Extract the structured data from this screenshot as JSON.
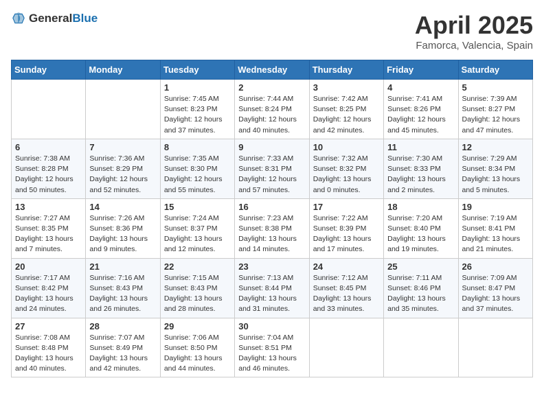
{
  "header": {
    "logo_general": "General",
    "logo_blue": "Blue",
    "month_year": "April 2025",
    "location": "Famorca, Valencia, Spain"
  },
  "weekdays": [
    "Sunday",
    "Monday",
    "Tuesday",
    "Wednesday",
    "Thursday",
    "Friday",
    "Saturday"
  ],
  "weeks": [
    [
      null,
      null,
      {
        "day": 1,
        "sunrise": "7:45 AM",
        "sunset": "8:23 PM",
        "daylight": "12 hours and 37 minutes."
      },
      {
        "day": 2,
        "sunrise": "7:44 AM",
        "sunset": "8:24 PM",
        "daylight": "12 hours and 40 minutes."
      },
      {
        "day": 3,
        "sunrise": "7:42 AM",
        "sunset": "8:25 PM",
        "daylight": "12 hours and 42 minutes."
      },
      {
        "day": 4,
        "sunrise": "7:41 AM",
        "sunset": "8:26 PM",
        "daylight": "12 hours and 45 minutes."
      },
      {
        "day": 5,
        "sunrise": "7:39 AM",
        "sunset": "8:27 PM",
        "daylight": "12 hours and 47 minutes."
      }
    ],
    [
      {
        "day": 6,
        "sunrise": "7:38 AM",
        "sunset": "8:28 PM",
        "daylight": "12 hours and 50 minutes."
      },
      {
        "day": 7,
        "sunrise": "7:36 AM",
        "sunset": "8:29 PM",
        "daylight": "12 hours and 52 minutes."
      },
      {
        "day": 8,
        "sunrise": "7:35 AM",
        "sunset": "8:30 PM",
        "daylight": "12 hours and 55 minutes."
      },
      {
        "day": 9,
        "sunrise": "7:33 AM",
        "sunset": "8:31 PM",
        "daylight": "12 hours and 57 minutes."
      },
      {
        "day": 10,
        "sunrise": "7:32 AM",
        "sunset": "8:32 PM",
        "daylight": "13 hours and 0 minutes."
      },
      {
        "day": 11,
        "sunrise": "7:30 AM",
        "sunset": "8:33 PM",
        "daylight": "13 hours and 2 minutes."
      },
      {
        "day": 12,
        "sunrise": "7:29 AM",
        "sunset": "8:34 PM",
        "daylight": "13 hours and 5 minutes."
      }
    ],
    [
      {
        "day": 13,
        "sunrise": "7:27 AM",
        "sunset": "8:35 PM",
        "daylight": "13 hours and 7 minutes."
      },
      {
        "day": 14,
        "sunrise": "7:26 AM",
        "sunset": "8:36 PM",
        "daylight": "13 hours and 9 minutes."
      },
      {
        "day": 15,
        "sunrise": "7:24 AM",
        "sunset": "8:37 PM",
        "daylight": "13 hours and 12 minutes."
      },
      {
        "day": 16,
        "sunrise": "7:23 AM",
        "sunset": "8:38 PM",
        "daylight": "13 hours and 14 minutes."
      },
      {
        "day": 17,
        "sunrise": "7:22 AM",
        "sunset": "8:39 PM",
        "daylight": "13 hours and 17 minutes."
      },
      {
        "day": 18,
        "sunrise": "7:20 AM",
        "sunset": "8:40 PM",
        "daylight": "13 hours and 19 minutes."
      },
      {
        "day": 19,
        "sunrise": "7:19 AM",
        "sunset": "8:41 PM",
        "daylight": "13 hours and 21 minutes."
      }
    ],
    [
      {
        "day": 20,
        "sunrise": "7:17 AM",
        "sunset": "8:42 PM",
        "daylight": "13 hours and 24 minutes."
      },
      {
        "day": 21,
        "sunrise": "7:16 AM",
        "sunset": "8:43 PM",
        "daylight": "13 hours and 26 minutes."
      },
      {
        "day": 22,
        "sunrise": "7:15 AM",
        "sunset": "8:43 PM",
        "daylight": "13 hours and 28 minutes."
      },
      {
        "day": 23,
        "sunrise": "7:13 AM",
        "sunset": "8:44 PM",
        "daylight": "13 hours and 31 minutes."
      },
      {
        "day": 24,
        "sunrise": "7:12 AM",
        "sunset": "8:45 PM",
        "daylight": "13 hours and 33 minutes."
      },
      {
        "day": 25,
        "sunrise": "7:11 AM",
        "sunset": "8:46 PM",
        "daylight": "13 hours and 35 minutes."
      },
      {
        "day": 26,
        "sunrise": "7:09 AM",
        "sunset": "8:47 PM",
        "daylight": "13 hours and 37 minutes."
      }
    ],
    [
      {
        "day": 27,
        "sunrise": "7:08 AM",
        "sunset": "8:48 PM",
        "daylight": "13 hours and 40 minutes."
      },
      {
        "day": 28,
        "sunrise": "7:07 AM",
        "sunset": "8:49 PM",
        "daylight": "13 hours and 42 minutes."
      },
      {
        "day": 29,
        "sunrise": "7:06 AM",
        "sunset": "8:50 PM",
        "daylight": "13 hours and 44 minutes."
      },
      {
        "day": 30,
        "sunrise": "7:04 AM",
        "sunset": "8:51 PM",
        "daylight": "13 hours and 46 minutes."
      },
      null,
      null,
      null
    ]
  ],
  "labels": {
    "sunrise": "Sunrise:",
    "sunset": "Sunset:",
    "daylight": "Daylight:"
  }
}
